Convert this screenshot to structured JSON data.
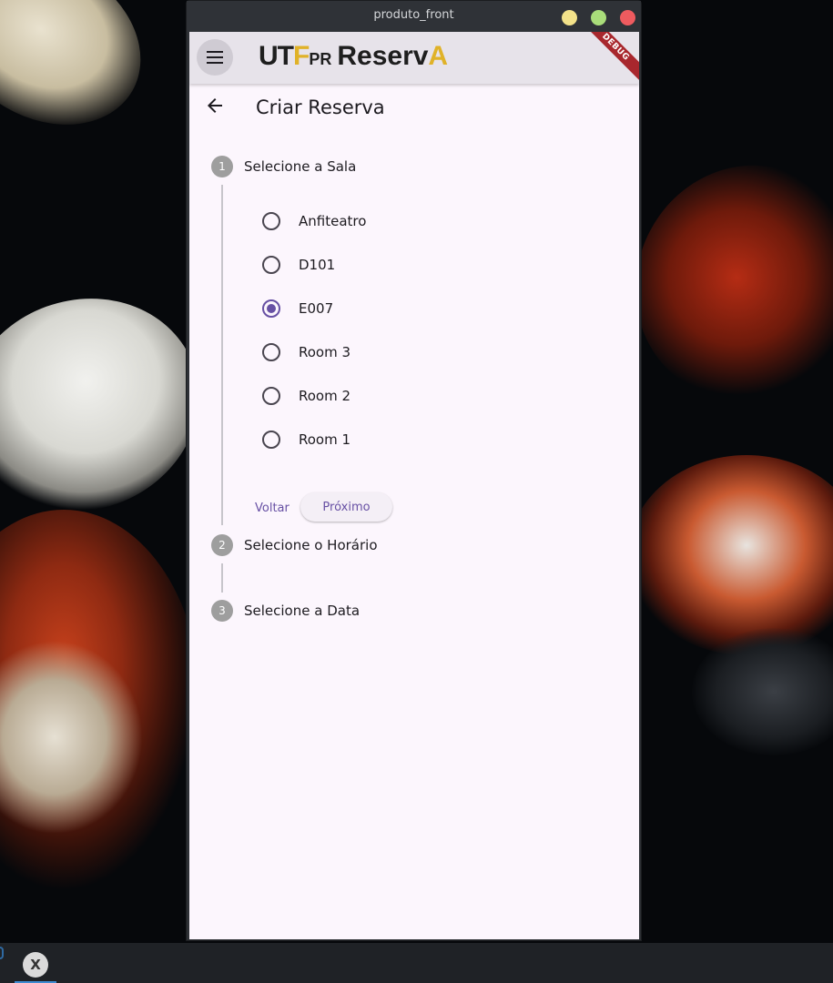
{
  "window": {
    "title": "produto_front"
  },
  "appbar": {
    "logo": {
      "utf_main": "UT",
      "utf_accent": "F",
      "utf_suffix": "PR",
      "reserv": "Reserv",
      "reserv_tail": "A"
    },
    "debug_badge": "DEBUG",
    "menu_icon": "hamburger-menu-icon"
  },
  "page": {
    "title": "Criar Reserva",
    "back_icon": "arrow-left-icon"
  },
  "stepper": {
    "steps": [
      {
        "number": "1",
        "label": "Selecione a Sala",
        "active": true
      },
      {
        "number": "2",
        "label": "Selecione o Horário",
        "active": false
      },
      {
        "number": "3",
        "label": "Selecione a Data",
        "active": false
      }
    ],
    "rooms": [
      {
        "label": "Anfiteatro",
        "selected": false
      },
      {
        "label": "D101",
        "selected": false
      },
      {
        "label": "E007",
        "selected": true
      },
      {
        "label": "Room 3",
        "selected": false
      },
      {
        "label": "Room 2",
        "selected": false
      },
      {
        "label": "Room 1",
        "selected": false
      }
    ],
    "back_label": "Voltar",
    "next_label": "Próximo"
  },
  "colors": {
    "primary": "#6750a4",
    "app_background": "#fcf6fd",
    "appbar_background": "#e7e3ea",
    "step_inactive": "#9e9e9e",
    "debug_ribbon": "#a8272d",
    "logo_accent": "#e0b228"
  },
  "taskbar": {
    "app_icon": "x-app-icon",
    "app_glyph": "X"
  }
}
